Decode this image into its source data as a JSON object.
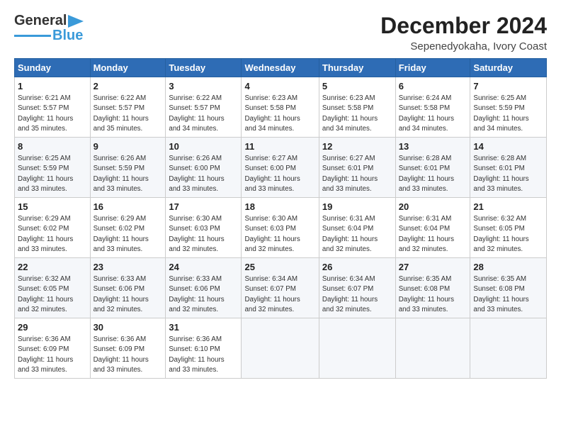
{
  "header": {
    "logo_line1": "General",
    "logo_line2": "Blue",
    "month": "December 2024",
    "location": "Sepenedyokaha, Ivory Coast"
  },
  "weekdays": [
    "Sunday",
    "Monday",
    "Tuesday",
    "Wednesday",
    "Thursday",
    "Friday",
    "Saturday"
  ],
  "weeks": [
    [
      {
        "day": "1",
        "info": "Sunrise: 6:21 AM\nSunset: 5:57 PM\nDaylight: 11 hours\nand 35 minutes."
      },
      {
        "day": "2",
        "info": "Sunrise: 6:22 AM\nSunset: 5:57 PM\nDaylight: 11 hours\nand 35 minutes."
      },
      {
        "day": "3",
        "info": "Sunrise: 6:22 AM\nSunset: 5:57 PM\nDaylight: 11 hours\nand 34 minutes."
      },
      {
        "day": "4",
        "info": "Sunrise: 6:23 AM\nSunset: 5:58 PM\nDaylight: 11 hours\nand 34 minutes."
      },
      {
        "day": "5",
        "info": "Sunrise: 6:23 AM\nSunset: 5:58 PM\nDaylight: 11 hours\nand 34 minutes."
      },
      {
        "day": "6",
        "info": "Sunrise: 6:24 AM\nSunset: 5:58 PM\nDaylight: 11 hours\nand 34 minutes."
      },
      {
        "day": "7",
        "info": "Sunrise: 6:25 AM\nSunset: 5:59 PM\nDaylight: 11 hours\nand 34 minutes."
      }
    ],
    [
      {
        "day": "8",
        "info": "Sunrise: 6:25 AM\nSunset: 5:59 PM\nDaylight: 11 hours\nand 33 minutes."
      },
      {
        "day": "9",
        "info": "Sunrise: 6:26 AM\nSunset: 5:59 PM\nDaylight: 11 hours\nand 33 minutes."
      },
      {
        "day": "10",
        "info": "Sunrise: 6:26 AM\nSunset: 6:00 PM\nDaylight: 11 hours\nand 33 minutes."
      },
      {
        "day": "11",
        "info": "Sunrise: 6:27 AM\nSunset: 6:00 PM\nDaylight: 11 hours\nand 33 minutes."
      },
      {
        "day": "12",
        "info": "Sunrise: 6:27 AM\nSunset: 6:01 PM\nDaylight: 11 hours\nand 33 minutes."
      },
      {
        "day": "13",
        "info": "Sunrise: 6:28 AM\nSunset: 6:01 PM\nDaylight: 11 hours\nand 33 minutes."
      },
      {
        "day": "14",
        "info": "Sunrise: 6:28 AM\nSunset: 6:01 PM\nDaylight: 11 hours\nand 33 minutes."
      }
    ],
    [
      {
        "day": "15",
        "info": "Sunrise: 6:29 AM\nSunset: 6:02 PM\nDaylight: 11 hours\nand 33 minutes."
      },
      {
        "day": "16",
        "info": "Sunrise: 6:29 AM\nSunset: 6:02 PM\nDaylight: 11 hours\nand 33 minutes."
      },
      {
        "day": "17",
        "info": "Sunrise: 6:30 AM\nSunset: 6:03 PM\nDaylight: 11 hours\nand 32 minutes."
      },
      {
        "day": "18",
        "info": "Sunrise: 6:30 AM\nSunset: 6:03 PM\nDaylight: 11 hours\nand 32 minutes."
      },
      {
        "day": "19",
        "info": "Sunrise: 6:31 AM\nSunset: 6:04 PM\nDaylight: 11 hours\nand 32 minutes."
      },
      {
        "day": "20",
        "info": "Sunrise: 6:31 AM\nSunset: 6:04 PM\nDaylight: 11 hours\nand 32 minutes."
      },
      {
        "day": "21",
        "info": "Sunrise: 6:32 AM\nSunset: 6:05 PM\nDaylight: 11 hours\nand 32 minutes."
      }
    ],
    [
      {
        "day": "22",
        "info": "Sunrise: 6:32 AM\nSunset: 6:05 PM\nDaylight: 11 hours\nand 32 minutes."
      },
      {
        "day": "23",
        "info": "Sunrise: 6:33 AM\nSunset: 6:06 PM\nDaylight: 11 hours\nand 32 minutes."
      },
      {
        "day": "24",
        "info": "Sunrise: 6:33 AM\nSunset: 6:06 PM\nDaylight: 11 hours\nand 32 minutes."
      },
      {
        "day": "25",
        "info": "Sunrise: 6:34 AM\nSunset: 6:07 PM\nDaylight: 11 hours\nand 32 minutes."
      },
      {
        "day": "26",
        "info": "Sunrise: 6:34 AM\nSunset: 6:07 PM\nDaylight: 11 hours\nand 32 minutes."
      },
      {
        "day": "27",
        "info": "Sunrise: 6:35 AM\nSunset: 6:08 PM\nDaylight: 11 hours\nand 33 minutes."
      },
      {
        "day": "28",
        "info": "Sunrise: 6:35 AM\nSunset: 6:08 PM\nDaylight: 11 hours\nand 33 minutes."
      }
    ],
    [
      {
        "day": "29",
        "info": "Sunrise: 6:36 AM\nSunset: 6:09 PM\nDaylight: 11 hours\nand 33 minutes."
      },
      {
        "day": "30",
        "info": "Sunrise: 6:36 AM\nSunset: 6:09 PM\nDaylight: 11 hours\nand 33 minutes."
      },
      {
        "day": "31",
        "info": "Sunrise: 6:36 AM\nSunset: 6:10 PM\nDaylight: 11 hours\nand 33 minutes."
      },
      null,
      null,
      null,
      null
    ]
  ]
}
